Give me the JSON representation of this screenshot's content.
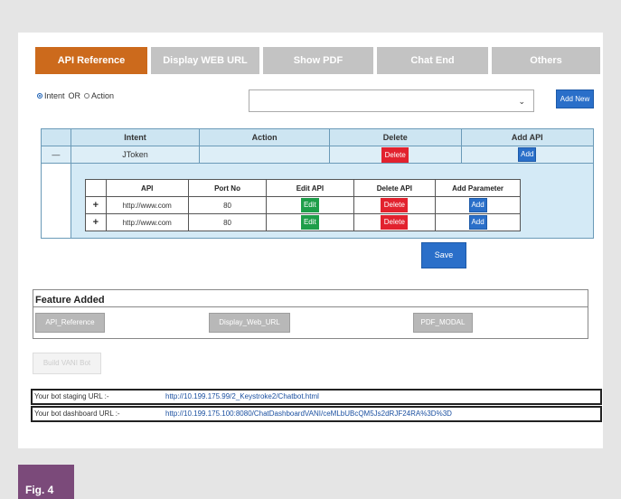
{
  "tabs": [
    "API Reference",
    "Display WEB URL",
    "Show PDF",
    "Chat End",
    "Others"
  ],
  "mode": {
    "intent_label": "Intent",
    "or_label": "OR",
    "action_label": "Action",
    "selected": "Intent"
  },
  "select": {
    "value": ""
  },
  "add_new_label": "Add New",
  "outer_table": {
    "headers": [
      "Intent",
      "Action",
      "Delete",
      "Add API"
    ],
    "row": {
      "toggle": "—",
      "intent": "JToken",
      "action": "",
      "delete_label": "Delete",
      "add_label": "Add"
    }
  },
  "inner_table": {
    "headers": [
      "API",
      "Port No",
      "Edit API",
      "Delete API",
      "Add Parameter"
    ],
    "rows": [
      {
        "plus": "+",
        "api": "http://www.com",
        "port": "80",
        "edit": "Edit",
        "delete": "Delete",
        "add": "Add"
      },
      {
        "plus": "+",
        "api": "http://www.com",
        "port": "80",
        "edit": "Edit",
        "delete": "Delete",
        "add": "Add"
      }
    ]
  },
  "save_label": "Save",
  "feature": {
    "title": "Feature Added",
    "chips": [
      "API_Reference",
      "Display_Web_URL",
      "PDF_MODAL"
    ]
  },
  "build_label": "Build VANI Bot",
  "urls": [
    {
      "label": "Your bot staging URL :-",
      "value": "http://10.199.175.99/2_Keystroke2/Chatbot.html"
    },
    {
      "label": "Your bot dashboard URL :-",
      "value": "http://10.199.175.100:8080/ChatDashboardVANI/ceMLbUBcQM5Js2dRJF24RA%3D%3D"
    }
  ],
  "figure_label": "Fig. 4",
  "colors": {
    "accent_tab": "#cc6a1c",
    "tab_inactive": "#c3c3c3",
    "button_blue": "#2a6fc9",
    "button_red": "#e2222e",
    "button_green": "#1e9e4a",
    "figure_tag": "#7b4a7a"
  }
}
